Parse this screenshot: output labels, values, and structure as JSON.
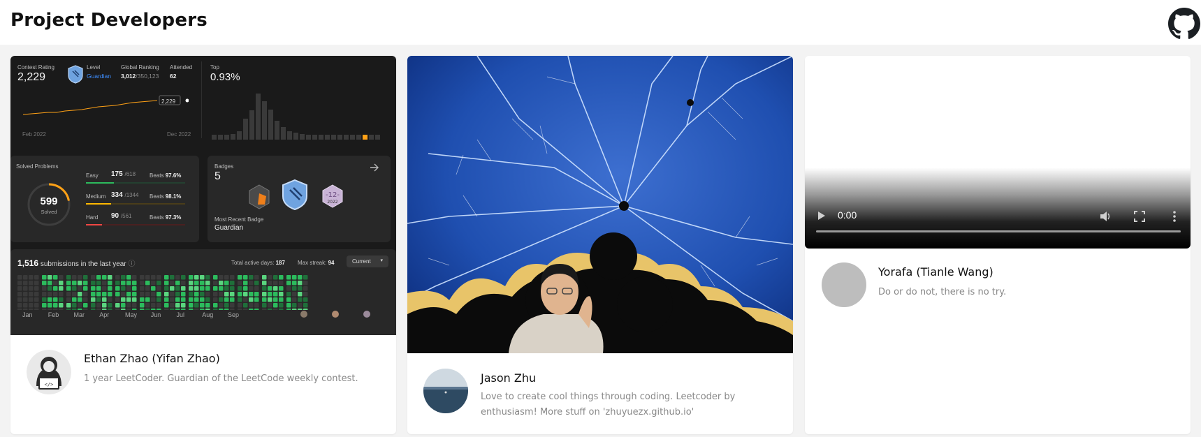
{
  "header": {
    "title": "Project Developers",
    "github_icon": "github-icon"
  },
  "cards": [
    {
      "name": "Ethan Zhao (Yifan Zhao)",
      "bio": "1 year LeetCoder. Guardian of the LeetCode weekly contest.",
      "avatar_icon": "hacker-laptop-icon",
      "leetcode": {
        "contest_rating_label": "Contest Rating",
        "contest_rating": "2,229",
        "level_label": "Level",
        "level": "Guardian",
        "global_ranking_label": "Global Ranking",
        "global_ranking": "3,012",
        "global_total": "/350,123",
        "attended_label": "Attended",
        "attended": "62",
        "top_label": "Top",
        "top": "0.93%",
        "rating_marker": "2,229",
        "start_date": "Feb 2022",
        "end_date": "Dec 2022",
        "solved_label": "Solved Problems",
        "solved": "599",
        "solved_sub": "Solved",
        "easy_label": "Easy",
        "easy": "175",
        "easy_total": "/618",
        "easy_beats_label": "Beats",
        "easy_beats": "97.6%",
        "easy_frac": 0.28,
        "medium_label": "Medium",
        "medium": "334",
        "medium_total": "/1344",
        "medium_beats_label": "Beats",
        "medium_beats": "98.1%",
        "medium_frac": 0.25,
        "hard_label": "Hard",
        "hard": "90",
        "hard_total": "/561",
        "hard_beats_label": "Beats",
        "hard_beats": "97.3%",
        "hard_frac": 0.16,
        "badges_label": "Badges",
        "badges_count": "5",
        "badge_year": "2022",
        "recent_badge_label": "Most Recent Badge",
        "recent_badge": "Guardian",
        "submissions": "1,516",
        "submissions_text": "submissions in the last year",
        "active_days_label": "Total active days:",
        "active_days": "187",
        "max_streak_label": "Max streak:",
        "max_streak": "94",
        "period_select": "Current",
        "months": [
          "Jan",
          "Feb",
          "Mar",
          "Apr",
          "May",
          "Jun",
          "Jul",
          "Aug",
          "Sep"
        ],
        "colors": {
          "easy": "#2cbb5d",
          "medium": "#ffb800",
          "hard": "#ef4743",
          "accent": "#ffa116"
        }
      }
    },
    {
      "name": "Jason Zhu",
      "bio_line1": "Love to create cool things through coding. Leetcoder by",
      "bio_line2": "enthusiasm! More stuff on 'zhuyuezx.github.io'",
      "avatar_icon": "ocean-photo-avatar",
      "image_icon": "mandelbrot-fractal-image"
    },
    {
      "name": "Yorafa (Tianle Wang)",
      "bio": "Do or do not, there is no try.",
      "avatar_icon": "placeholder-avatar",
      "video": {
        "time": "0:00"
      }
    }
  ]
}
